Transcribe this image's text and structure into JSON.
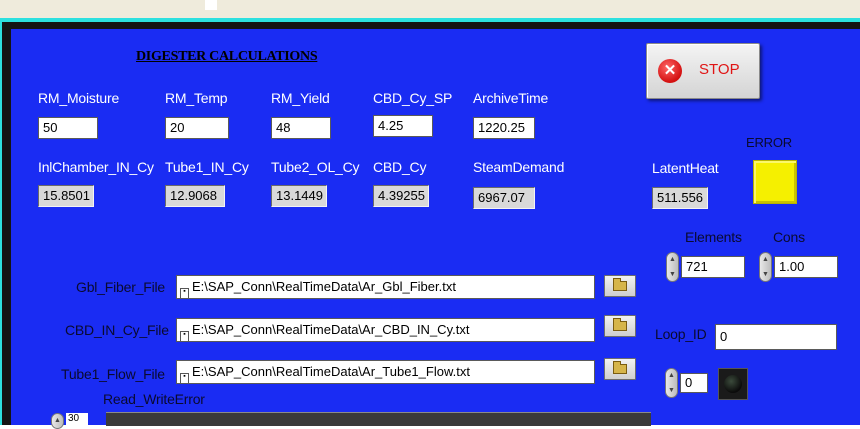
{
  "title": "DIGESTER CALCULATIONS",
  "stop_label": "STOP",
  "stop_icon": "x-icon",
  "inputs": [
    {
      "label": "RM_Moisture",
      "value": "50"
    },
    {
      "label": "RM_Temp",
      "value": "20"
    },
    {
      "label": "RM_Yield",
      "value": "48"
    },
    {
      "label": "CBD_Cy_SP",
      "value": "4.25"
    },
    {
      "label": "ArchiveTime",
      "value": "1220.25"
    }
  ],
  "outputs": [
    {
      "label": "InlChamber_IN_Cy",
      "value": "15.8501"
    },
    {
      "label": "Tube1_IN_Cy",
      "value": "12.9068"
    },
    {
      "label": "Tube2_OL_Cy",
      "value": "13.1449"
    },
    {
      "label": "CBD_Cy",
      "value": "4.39255"
    },
    {
      "label": "SteamDemand",
      "value": "6967.07"
    },
    {
      "label": "LatentHeat",
      "value": "511.556"
    }
  ],
  "error_label": "ERROR",
  "error_led_color": "#f5f000",
  "elements": {
    "label": "Elements",
    "value": "721"
  },
  "cons": {
    "label": "Cons",
    "value": "1.00"
  },
  "files": [
    {
      "label": "Gbl_Fiber_File",
      "path": "E:\\SAP_Conn\\RealTimeData\\Ar_Gbl_Fiber.txt"
    },
    {
      "label": "CBD_IN_Cy_File",
      "path": "E:\\SAP_Conn\\RealTimeData\\Ar_CBD_IN_Cy.txt"
    },
    {
      "label": "Tube1_Flow_File",
      "path": "E:\\SAP_Conn\\RealTimeData\\Ar_Tube1_Flow.txt"
    }
  ],
  "loop_id": {
    "label": "Loop_ID",
    "value": "0"
  },
  "counter": {
    "value": "0"
  },
  "read_write_error": {
    "label": "Read_WriteError",
    "value": "30"
  },
  "colors": {
    "panel_bg": "#1a2cf3",
    "frame": "#2de0df",
    "label_text": "#ffffff",
    "stop_text": "#e01515"
  }
}
